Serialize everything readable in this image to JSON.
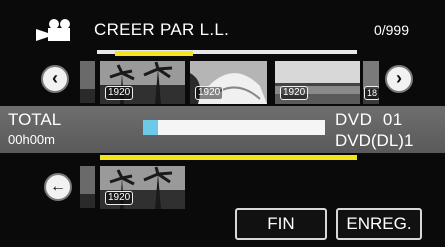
{
  "header": {
    "title": "CREER PAR L.L.",
    "counter": "0/999"
  },
  "source_strip": {
    "thumbnails": [
      {
        "resolution": "1920"
      },
      {
        "resolution": "1920"
      },
      {
        "resolution": "1920"
      },
      {
        "resolution": "18"
      }
    ]
  },
  "status": {
    "total_label": "TOTAL",
    "total_time": "00h00m",
    "progress": 0.08,
    "disc_line1": "DVD  01",
    "disc_line2": "DVD(DL)1"
  },
  "playlist": {
    "thumbnails": [
      {
        "resolution": "1920"
      }
    ]
  },
  "buttons": {
    "fin": "FIN",
    "enreg": "ENREG."
  },
  "icons": {
    "camera": "movie-camera-icon",
    "prev": "chevron-left-icon",
    "next": "chevron-right-icon",
    "back": "arrow-left-icon"
  },
  "colors": {
    "accent_yellow": "#f2e61a",
    "progress_fill": "#6ec8e8",
    "strip": "#666666"
  }
}
